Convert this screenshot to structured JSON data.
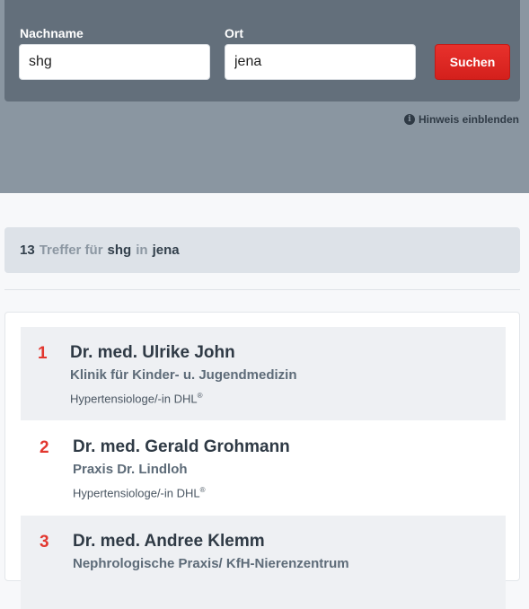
{
  "search": {
    "lastname_label": "Nachname",
    "lastname_value": "shg",
    "city_label": "Ort",
    "city_value": "jena",
    "submit_label": "Suchen",
    "hint_label": "Hinweis einblenden",
    "hint_icon": "info-icon"
  },
  "summary": {
    "count": "13",
    "text_for": "Treffer für",
    "query": "shg",
    "text_in": "in",
    "city": "jena"
  },
  "results": [
    {
      "number": "1",
      "name": "Dr. med. Ulrike John",
      "practice": "Klinik für Kinder- u. Jugendmedizin",
      "specialty": "Hypertensiologe/-in DHL",
      "mark": "®"
    },
    {
      "number": "2",
      "name": "Dr. med. Gerald Grohmann",
      "practice": "Praxis Dr. Lindloh",
      "specialty": "Hypertensiologe/-in DHL",
      "mark": "®"
    },
    {
      "number": "3",
      "name": "Dr. med. Andree Klemm",
      "practice": "Nephrologische Praxis/ KfH-Nierenzentrum",
      "specialty": "",
      "mark": ""
    }
  ],
  "colors": {
    "accent_red": "#e2372f",
    "header_dark": "#636f7b",
    "header_light": "#8a96a1"
  }
}
